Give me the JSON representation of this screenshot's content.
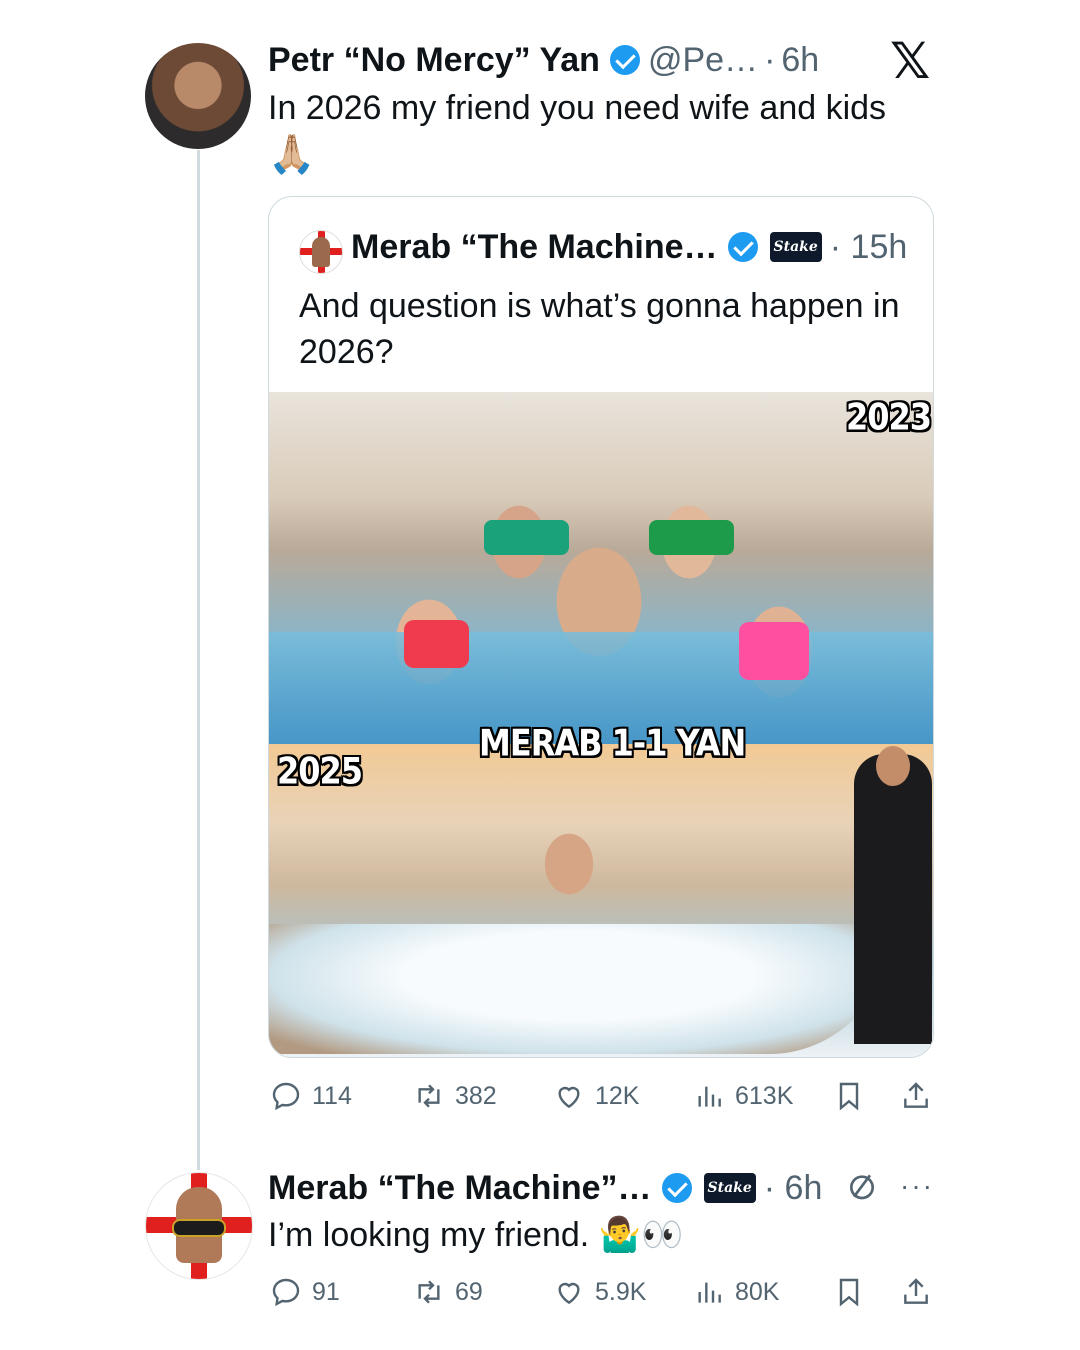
{
  "main_tweet": {
    "name": "Petr “No Mercy” Yan",
    "handle": "@Pe…",
    "sep": "·",
    "time": "6h",
    "text_line1": "In 2026 my friend you need wife and kids",
    "text_line2": "🙏🏼"
  },
  "quoted_tweet": {
    "name": "Merab “The Machine…",
    "badge": "Stake",
    "time_text": "· 15h",
    "text": "And question is what’s gonna happen in 2026?",
    "meme": {
      "top_label": "2023",
      "middle_label": "MERAB 1-1 YAN",
      "bottom_label": "2025"
    }
  },
  "main_actions": {
    "replies": "114",
    "reposts": "382",
    "likes": "12K",
    "views": "613K"
  },
  "reply_tweet": {
    "name": "Merab “The Machine”…",
    "badge": "Stake",
    "time_text": "· 6h",
    "more": "···",
    "text": "I’m looking my friend. 🤷‍♂️👀"
  },
  "reply_actions": {
    "replies": "91",
    "reposts": "69",
    "likes": "5.9K",
    "views": "80K"
  },
  "icons": {
    "app_logo": "x-logo-icon",
    "verified": "verified-badge-icon",
    "reply": "reply-icon",
    "repost": "repost-icon",
    "like": "heart-icon",
    "views": "views-icon",
    "bookmark": "bookmark-icon",
    "share": "share-icon"
  },
  "colors": {
    "verified": "#1d9bf0",
    "secondary_text": "#536471",
    "border": "#cfd9de"
  }
}
